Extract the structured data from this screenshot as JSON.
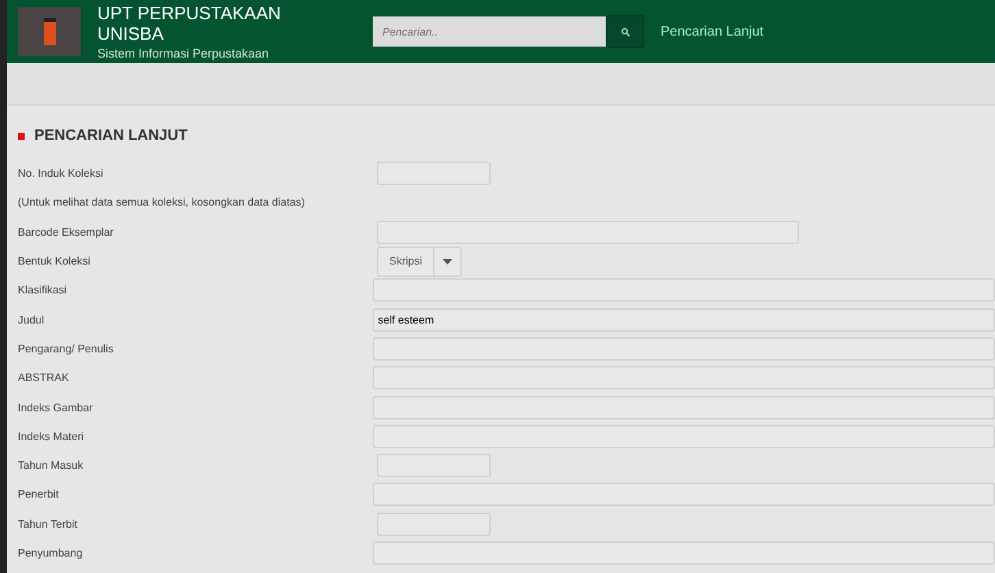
{
  "header": {
    "title": "UPT PERPUSTAKAAN UNISBA",
    "subtitle": "Sistem Informasi Perpustakaan",
    "search": {
      "placeholder": "Pencarian.."
    },
    "nav_link": "Pencarian Lanjut"
  },
  "section_title": "PENCARIAN LANJUT",
  "fields": [
    {
      "kind": "short",
      "label": "No. Induk Koleksi"
    },
    {
      "kind": "note",
      "label": "(Untuk melihat data semua koleksi, kosongkan data diatas)"
    },
    {
      "kind": "medium",
      "label": "Barcode Eksemplar"
    },
    {
      "kind": "select",
      "label": "Bentuk Koleksi",
      "value": "Skripsi"
    },
    {
      "kind": "full",
      "label": "Klasifikasi"
    },
    {
      "kind": "full",
      "label": "Judul",
      "value": "self esteem"
    },
    {
      "kind": "full",
      "label": "Pengarang/ Penulis"
    },
    {
      "kind": "full",
      "label": "ABSTRAK"
    },
    {
      "kind": "full",
      "label": "Indeks Gambar"
    },
    {
      "kind": "full",
      "label": "Indeks Materi"
    },
    {
      "kind": "short",
      "label": "Tahun Masuk"
    },
    {
      "kind": "full",
      "label": "Penerbit"
    },
    {
      "kind": "short",
      "label": "Tahun Terbit"
    },
    {
      "kind": "full",
      "label": "Penyumbang"
    }
  ]
}
